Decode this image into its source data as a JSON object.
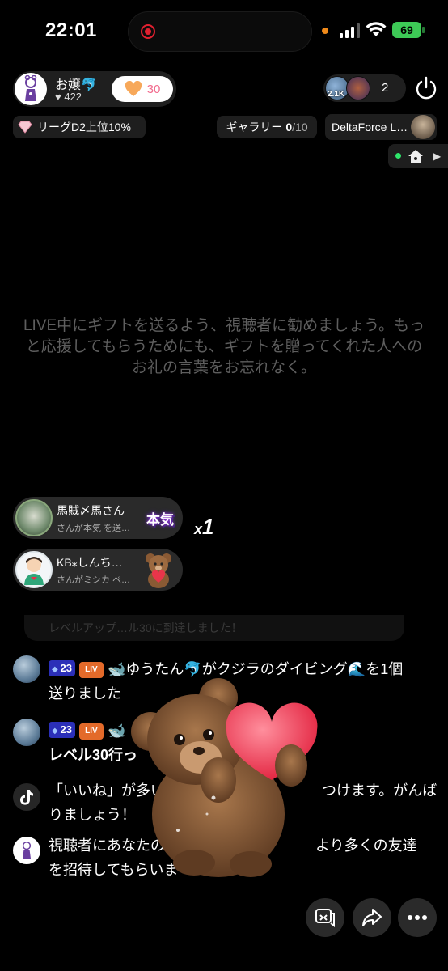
{
  "status": {
    "time": "22:01",
    "battery": "69"
  },
  "host": {
    "name": "お嬢🐬",
    "likes": "422",
    "follow_count": "30"
  },
  "top": {
    "league": "リーグD2上位10%",
    "gallery_label": "ギャラリー",
    "gallery_count": "0",
    "gallery_total": "/10",
    "game": "DeltaForce L…",
    "viewer_badge": "2.1K",
    "viewer_count": "2"
  },
  "hint": "LIVE中にギフトを送るよう、視聴者に勧めましょう。もっと応援してもらうためにも、ギフトを贈ってくれた人へのお礼の言葉をお忘れなく。",
  "gifts": [
    {
      "name": "馬賊〆馬さん",
      "sub": "さんが本気 を送…",
      "sticker": "本気"
    },
    {
      "name": "KB⁎しんち…",
      "sub": "さんがミシカ ベ…"
    }
  ],
  "combo": {
    "prefix": "x",
    "count": "1"
  },
  "faded_text": "レベルアップ…ル30に到達しました！",
  "chat": [
    {
      "level": "23",
      "text_line1": "🐋ゆうたん🐬がクジラのダイビング🌊を1個",
      "text_line2": "送りました"
    },
    {
      "level": "23",
      "text_line1": "🐋",
      "text_line2": "レベル30行っ"
    },
    {
      "text_line1": "「いいね」が多い",
      "text_line1b": "つけます。がんば",
      "text_line2": "りましょう！"
    },
    {
      "text_line1": "視聴者にあなたのLIV",
      "text_line1b": "より多くの友達",
      "text_line2": "を招待してもらいま"
    }
  ],
  "icons": {
    "heart": "heart-icon",
    "power": "power-icon",
    "home": "home-icon",
    "tiktok": "tiktok-icon",
    "share": "share-icon",
    "more": "more-icon",
    "chat": "chat-icon"
  },
  "colors": {
    "accent": "#f26a8d",
    "battery": "#3dc956",
    "live_badge": "#e36a2a",
    "level_badge": "#2b2fb8"
  }
}
